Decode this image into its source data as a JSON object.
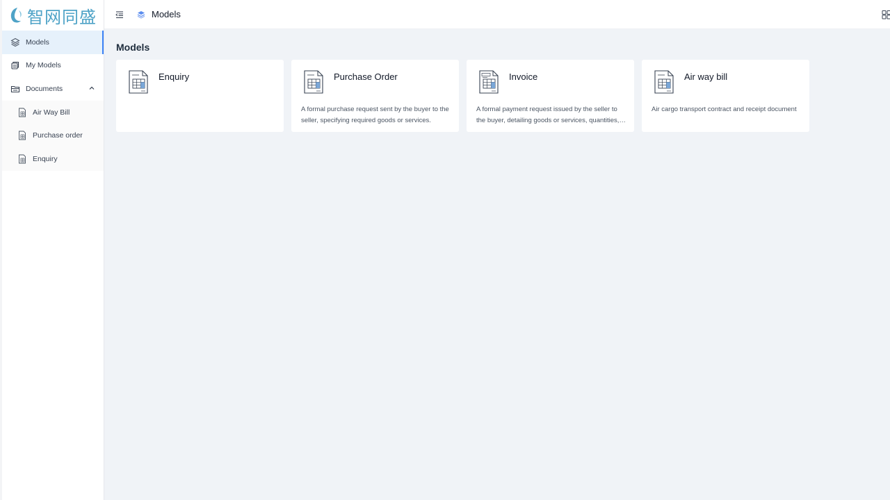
{
  "brand": {
    "name": "智网同盛"
  },
  "header": {
    "breadcrumb": "Models"
  },
  "sidebar": {
    "items": [
      {
        "label": "Models"
      },
      {
        "label": "My Models"
      },
      {
        "label": "Documents"
      },
      {
        "label": "Air Way Bill"
      },
      {
        "label": "Purchase order"
      },
      {
        "label": "Enquiry"
      }
    ]
  },
  "main": {
    "title": "Models",
    "cards": [
      {
        "title": "Enquiry",
        "description": ""
      },
      {
        "title": "Purchase Order",
        "description": "A formal purchase request sent by the buyer to the seller, specifying required goods or services."
      },
      {
        "title": "Invoice",
        "description": "A formal payment request issued by the seller to the buyer, detailing goods or services, quantities, prices and payment terms."
      },
      {
        "title": "Air way bill",
        "description": "Air cargo transport contract and receipt document"
      }
    ]
  },
  "colors": {
    "brand": "#4fa3c7",
    "accent": "#3b82f6",
    "active_bg": "#e6f1fb",
    "background": "#f0f3f7"
  },
  "icons": {
    "models": "layers-icon",
    "my_models": "stack-icon",
    "documents": "folder-icon",
    "document": "document-icon"
  }
}
